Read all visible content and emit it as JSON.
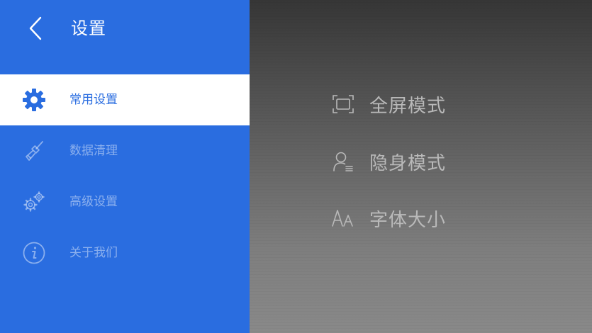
{
  "header": {
    "title": "设置",
    "back_icon": "chevron-left-icon"
  },
  "sidebar": {
    "items": [
      {
        "label": "常用设置",
        "icon": "gear-icon",
        "active": true
      },
      {
        "label": "数据清理",
        "icon": "broom-icon",
        "active": false
      },
      {
        "label": "高级设置",
        "icon": "gears-icon",
        "active": false
      },
      {
        "label": "关于我们",
        "icon": "info-icon",
        "active": false
      }
    ]
  },
  "options": [
    {
      "label": "全屏模式",
      "icon": "fullscreen-icon"
    },
    {
      "label": "隐身模式",
      "icon": "incognito-user-icon"
    },
    {
      "label": "字体大小",
      "icon": "font-size-icon"
    }
  ],
  "colors": {
    "accent": "#2a6de0",
    "option_text": "#b9b9b9"
  }
}
